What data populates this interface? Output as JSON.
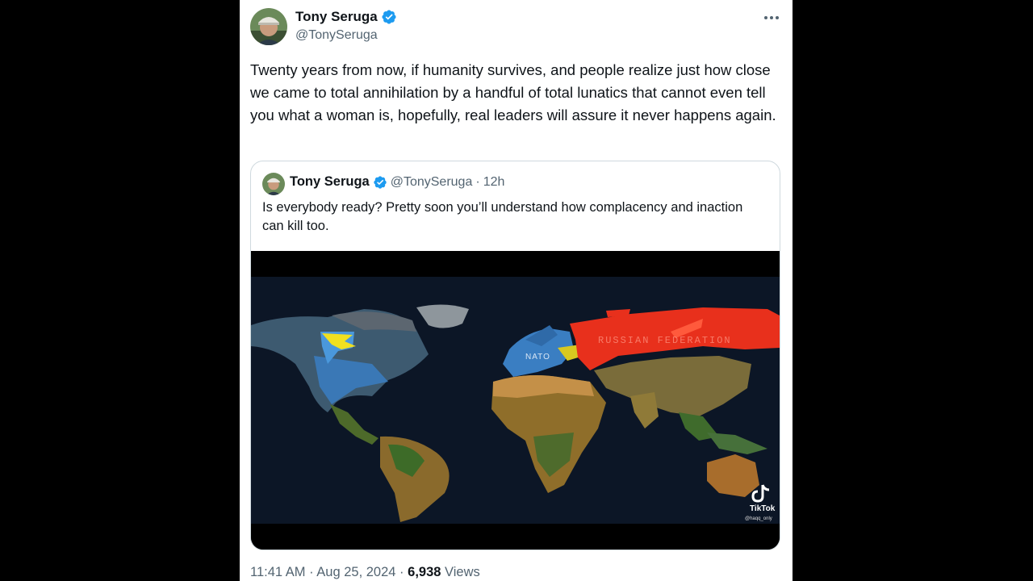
{
  "author": {
    "name": "Tony Seruga",
    "handle": "@TonySeruga"
  },
  "tweet": {
    "text": "Twenty years from now, if humanity survives, and people realize just how close we came to total annihilation by a handful of total lunatics that cannot even tell you what a woman is, hopefully, real leaders will assure it never happens again."
  },
  "quoted": {
    "name": "Tony Seruga",
    "handle": "@TonySeruga",
    "separator": "·",
    "time": "12h",
    "text": "Is everybody ready? Pretty soon you’ll understand how complacency and inaction can kill too.",
    "media": {
      "map_label_nato": "NATO",
      "map_label_russia": "RUSSIAN FEDERATION",
      "watermark": "TikTok",
      "watermark_handle": "@haqq_only"
    }
  },
  "footer": {
    "time": "11:41 AM",
    "separator1": "·",
    "date": "Aug 25, 2024",
    "separator2": "·",
    "views_count": "6,938",
    "views_label": "Views"
  },
  "colors": {
    "verified": "#1d9bf0",
    "text_primary": "#0f1419",
    "text_secondary": "#536471",
    "border": "#cfd9de"
  },
  "icons": [
    "verified-badge-icon",
    "more-options-icon",
    "tiktok-logo-icon"
  ]
}
